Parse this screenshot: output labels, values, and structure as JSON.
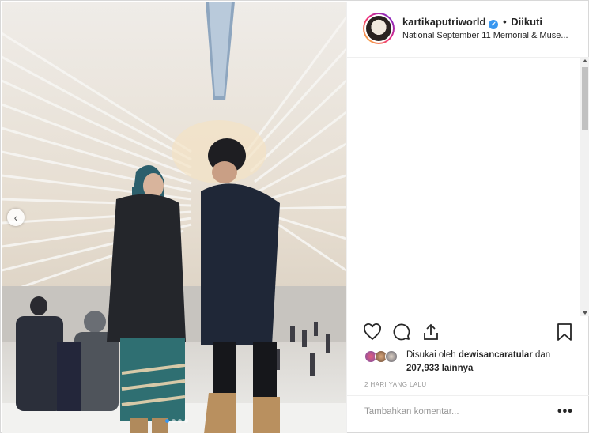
{
  "post": {
    "username": "kartikaputriworld",
    "separator": "•",
    "follow_status": "Diikuti",
    "location": "National September 11 Memorial & Muse...",
    "likes_prefix": "Disukai oleh ",
    "likes_user": "dewisancaratular",
    "likes_mid": " dan",
    "likes_count": "207,933 lainnya",
    "timestamp": "2 HARI YANG LALU",
    "comment_placeholder": "Tambahkan komentar...",
    "more_label": "•••",
    "prev_arrow": "‹",
    "verified_mark": "✓"
  },
  "carousel": {
    "slides": 4,
    "active_index": 0
  },
  "colors": {
    "accent": "#3897f0",
    "text": "#262626",
    "muted": "#999999"
  },
  "icons": [
    "heart-icon",
    "comment-icon",
    "share-icon",
    "bookmark-icon",
    "verified-icon",
    "chevron-left-icon"
  ]
}
